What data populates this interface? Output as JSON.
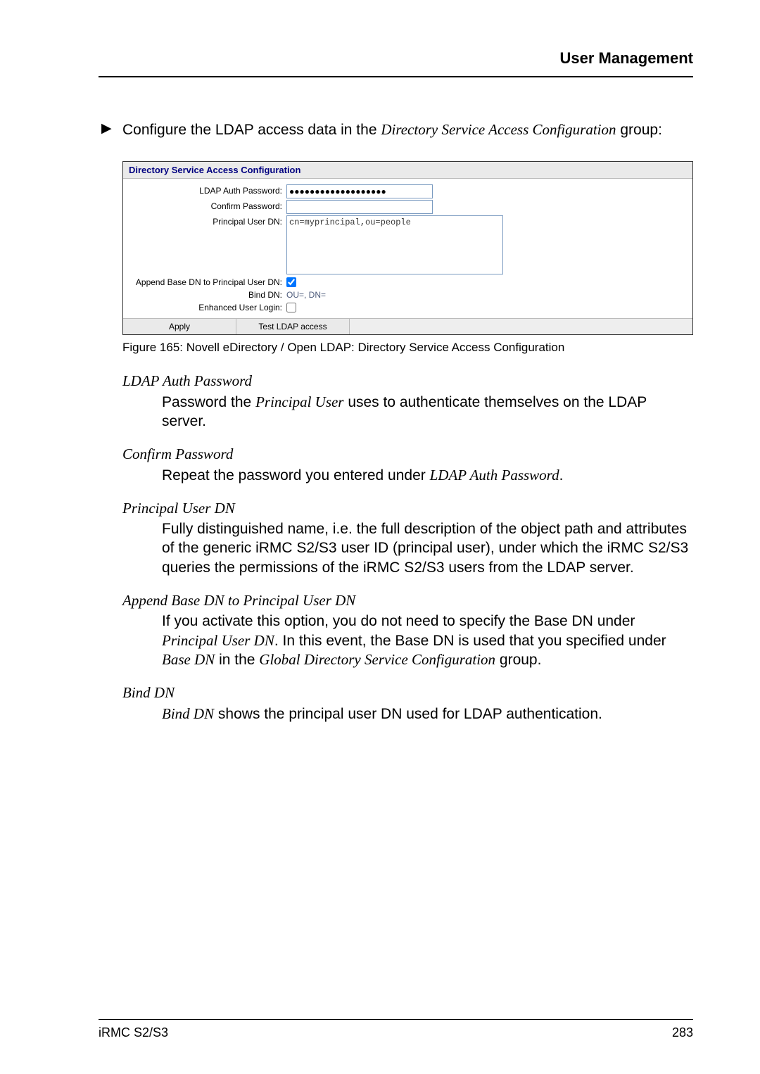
{
  "header": {
    "title": "User Management"
  },
  "intro": {
    "bullet": "▶",
    "text_before": "Configure the LDAP access data in the ",
    "text_italic": "Directory Service Access Configuration",
    "text_after": " group:"
  },
  "screenshot": {
    "panel_title": "Directory Service Access Configuration",
    "rows": {
      "ldap_auth_password": {
        "label": "LDAP Auth Password:",
        "value": "●●●●●●●●●●●●●●●●●●●"
      },
      "confirm_password": {
        "label": "Confirm Password:",
        "value": ""
      },
      "principal_user_dn": {
        "label": "Principal User DN:",
        "value": "cn=myprincipal,ou=people"
      },
      "append_base_dn": {
        "label": "Append Base DN to Principal User DN:",
        "checked": true
      },
      "bind_dn": {
        "label": "Bind DN:",
        "value": "OU=, DN="
      },
      "enhanced_user_login": {
        "label": "Enhanced User Login:",
        "checked": false
      }
    },
    "buttons": {
      "apply": "Apply",
      "test": "Test LDAP access"
    }
  },
  "caption": "Figure 165: Novell eDirectory / Open LDAP: Directory Service Access Configuration",
  "definitions": {
    "ldap_auth_password": {
      "term": "LDAP Auth Password",
      "desc_before": "Password the ",
      "desc_italic": "Principal User",
      "desc_after": " uses to authenticate themselves on the LDAP server."
    },
    "confirm_password": {
      "term": "Confirm Password",
      "desc_before": "Repeat the password you entered under ",
      "desc_italic": "LDAP Auth Password",
      "desc_after": "."
    },
    "principal_user_dn": {
      "term": "Principal User DN",
      "desc": "Fully distinguished name, i.e. the full description of the object path and attributes of the generic iRMC S2/S3 user ID (principal user), under which the iRMC S2/S3 queries the permissions of the iRMC S2/S3 users from the LDAP server."
    },
    "append_base_dn": {
      "term": "Append Base DN to Principal User DN",
      "p1a": "If you activate this option, you do not need to specify the Base DN under ",
      "p1i1": "Principal User DN",
      "p1b": ". In this event, the Base DN is used that you specified under ",
      "p1i2": "Base DN",
      "p1c": " in the ",
      "p1i3": "Global Directory Service Configuration",
      "p1d": " group."
    },
    "bind_dn": {
      "term": "Bind DN",
      "desc_italic": "Bind DN",
      "desc_after": " shows the principal user DN used for LDAP authentication."
    }
  },
  "footer": {
    "left": "iRMC S2/S3",
    "right": "283"
  }
}
